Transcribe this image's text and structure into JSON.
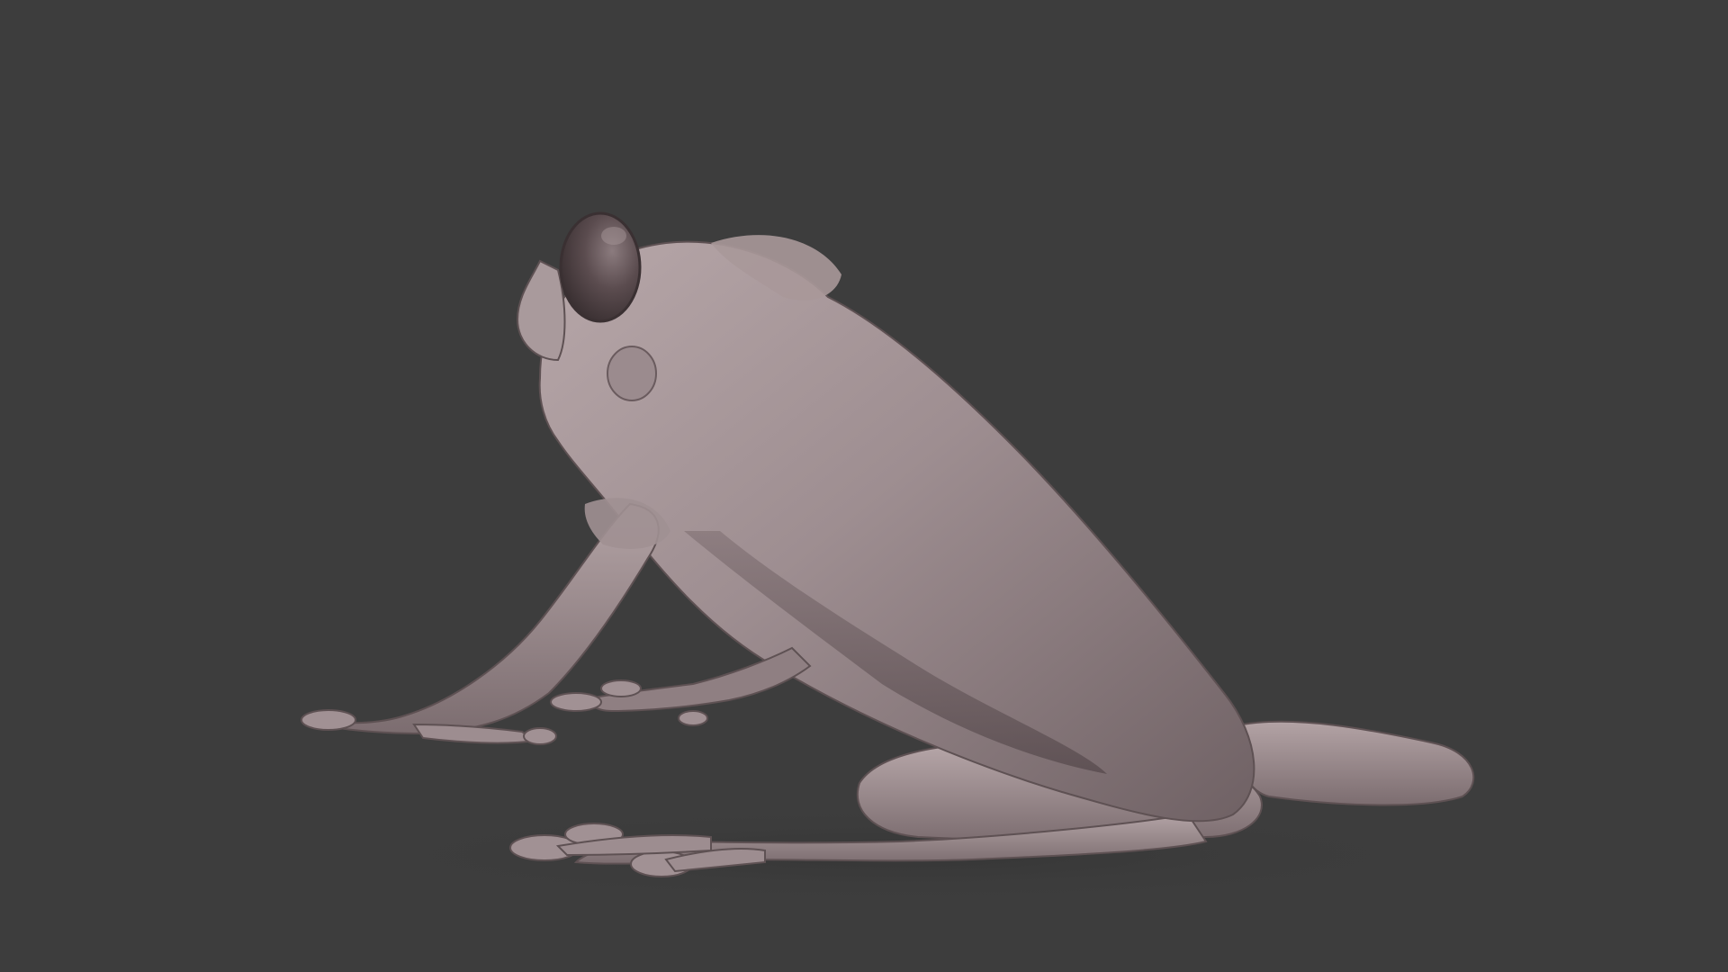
{
  "scene": {
    "subject": "frog-sculpt",
    "colors": {
      "background": "#3d3d3d",
      "clay_light": "#b4a4a6",
      "clay_mid": "#8f7f82",
      "clay_dark": "#5e5153",
      "clay_shadow": "#463c3e",
      "eye_dark": "#4a3c3e"
    }
  }
}
